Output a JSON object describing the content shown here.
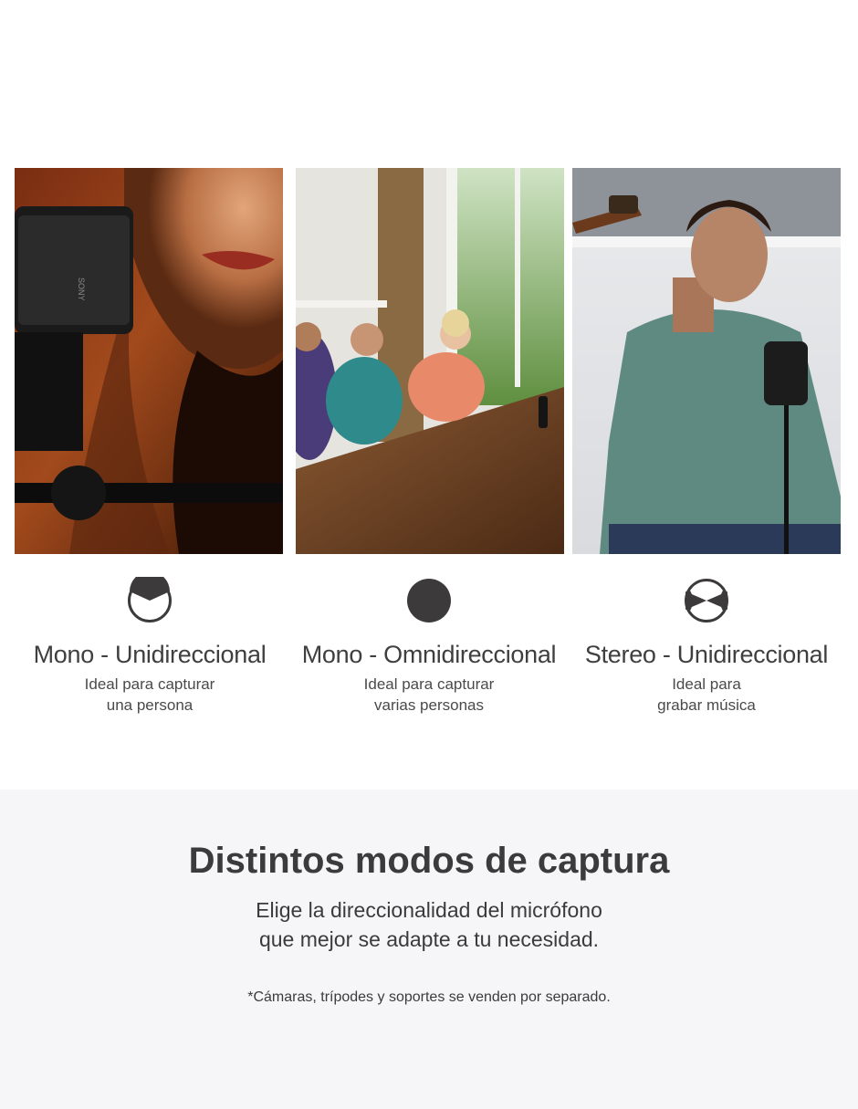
{
  "modes": [
    {
      "icon": "half-moon-polar-pattern-icon",
      "title": "Mono - Unidireccional",
      "desc_line1": "Ideal para capturar",
      "desc_line2": "una persona"
    },
    {
      "icon": "full-circle-polar-pattern-icon",
      "title": "Mono - Omnidireccional",
      "desc_line1": "Ideal para capturar",
      "desc_line2": "varias personas"
    },
    {
      "icon": "bowtie-polar-pattern-icon",
      "title": "Stereo - Unidireccional",
      "desc_line1": "Ideal para",
      "desc_line2": "grabar música"
    }
  ],
  "photos": {
    "photo_1_brand": "SONY"
  },
  "section": {
    "title": "Distintos modos de captura",
    "subtitle_line1": "Elige la direccionalidad del micrófono",
    "subtitle_line2": "que mejor se adapte a tu necesidad.",
    "note": "*Cámaras, trípodes y soportes se venden por separado."
  },
  "colors": {
    "icon": "#3d3a3b",
    "text": "#3b3b3d",
    "band_background": "#f6f6f8"
  }
}
